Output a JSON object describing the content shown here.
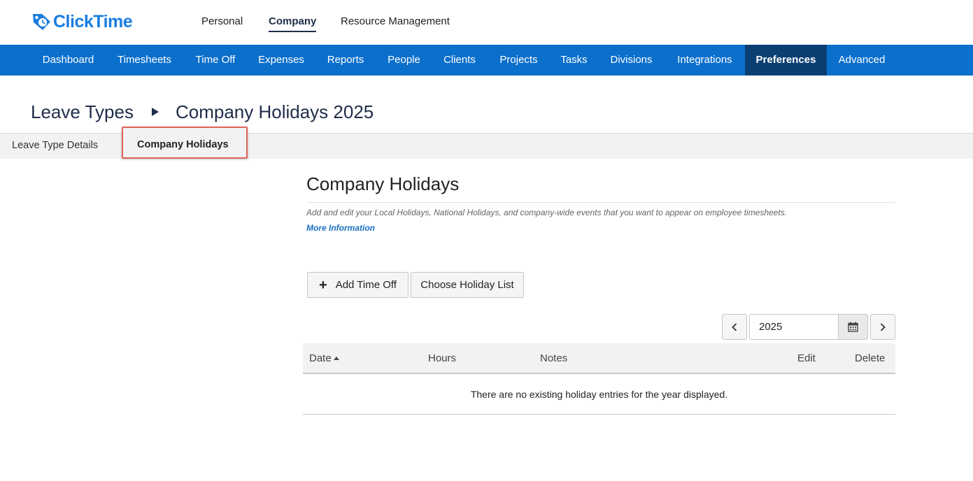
{
  "brand": {
    "name": "ClickTime",
    "color": "#1a7ee0",
    "icon": "tag-clock-icon"
  },
  "top_tabs": [
    {
      "label": "Personal",
      "active": false
    },
    {
      "label": "Company",
      "active": true
    },
    {
      "label": "Resource Management",
      "active": false
    }
  ],
  "nav": {
    "color": "#0b6fcc",
    "active_color": "#0b3f73",
    "items": [
      {
        "label": "Dashboard"
      },
      {
        "label": "Timesheets"
      },
      {
        "label": "Time Off"
      },
      {
        "label": "Expenses"
      },
      {
        "label": "Reports"
      },
      {
        "label": "People"
      },
      {
        "label": "Clients"
      },
      {
        "label": "Projects"
      },
      {
        "label": "Tasks"
      },
      {
        "label": "Divisions"
      },
      {
        "label": "Integrations"
      },
      {
        "label": "Preferences",
        "active": true
      },
      {
        "label": "Advanced"
      }
    ]
  },
  "breadcrumb": {
    "parent": "Leave Types",
    "current": "Company Holidays 2025"
  },
  "subtabs": [
    {
      "label": "Leave Type Details",
      "active": false
    },
    {
      "label": "Company Holidays",
      "active": true
    }
  ],
  "highlight_color": "#e0635a",
  "section": {
    "title": "Company Holidays",
    "description": "Add and edit your Local Holidays, National Holidays, and company-wide events that you want to appear on employee timesheets.",
    "more_link": "More Information"
  },
  "actions": {
    "add_time_off": "Add Time Off",
    "choose_holiday_list": "Choose Holiday List"
  },
  "year_picker": {
    "value": "2025",
    "prev_icon": "chevron-left-icon",
    "next_icon": "chevron-right-icon",
    "calendar_icon": "calendar-icon"
  },
  "table": {
    "columns": [
      "Date",
      "Hours",
      "Notes",
      "Edit",
      "Delete"
    ],
    "sort_column": "Date",
    "empty_message": "There are no existing holiday entries for the year displayed."
  }
}
